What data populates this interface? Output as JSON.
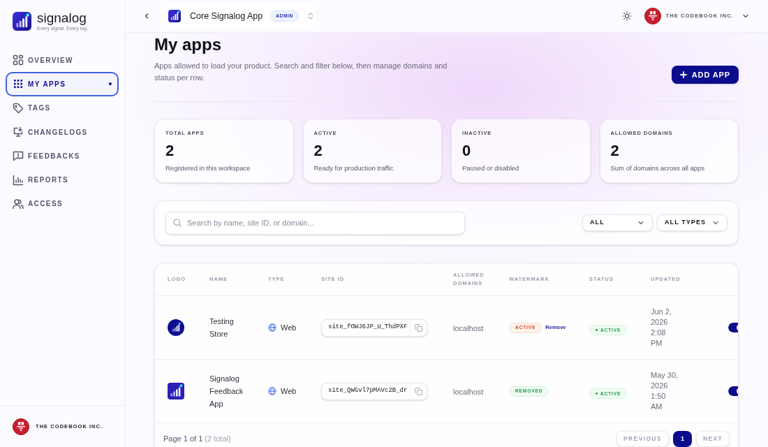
{
  "sidebar": {
    "brand": {
      "name": "signalog",
      "tagline": "Every signal. Every log."
    },
    "items": [
      {
        "label": "OVERVIEW",
        "selected": false
      },
      {
        "label": "MY APPS",
        "selected": true
      },
      {
        "label": "TAGS",
        "selected": false
      },
      {
        "label": "CHANGELOGS",
        "selected": false
      },
      {
        "label": "FEEDBACKS",
        "selected": false
      },
      {
        "label": "REPORTS",
        "selected": false
      },
      {
        "label": "ACCESS",
        "selected": false
      }
    ],
    "org": {
      "name": "THE CODEBOOK INC."
    }
  },
  "topbar": {
    "app": {
      "name": "Core Signalog App",
      "badge": "ADMIN"
    },
    "org": {
      "name": "THE CODEBOOK INC."
    }
  },
  "header": {
    "title": "My apps",
    "description": "Apps allowed to load your product. Search and filter below, then manage domains and status per row.",
    "action": "ADD APP"
  },
  "stats": [
    {
      "label": "TOTAL APPS",
      "value": "2",
      "note": "Registered in this workspace"
    },
    {
      "label": "ACTIVE",
      "value": "2",
      "note": "Ready for production traffic"
    },
    {
      "label": "INACTIVE",
      "value": "0",
      "note": "Paused or disabled"
    },
    {
      "label": "ALLOWED DOMAINS",
      "value": "2",
      "note": "Sum of domains across all apps"
    }
  ],
  "filters": {
    "search": {
      "placeholder": "Search by name, site ID, or domain..."
    },
    "selects": [
      {
        "value": "ALL"
      },
      {
        "value": "ALL TYPES"
      }
    ]
  },
  "table": {
    "columns": [
      "LOGO",
      "NAME",
      "TYPE",
      "SITE ID",
      "ALLOWED DOMAINS",
      "WATERMARK",
      "STATUS",
      "UPDATED"
    ],
    "rows": [
      {
        "logo": {
          "kind": "circle"
        },
        "name": "Testing Store",
        "type": "Web",
        "site_id": "site_fOWJ6JP_U_ThdPXF",
        "domains": "localhost",
        "watermark": {
          "kind": "active",
          "label": "ACTIVE",
          "action": "Remove"
        },
        "status": {
          "kind": "active",
          "label": "ACTIVE"
        },
        "updated": "Jun 2, 2026 2:08 PM",
        "on": true
      },
      {
        "logo": {
          "kind": "square"
        },
        "name": "Signalog Feedback App",
        "type": "Web",
        "site_id": "site_QWGvl7pMAVc2B_dr",
        "domains": "localhost",
        "watermark": {
          "kind": "removed",
          "label": "REMOVED"
        },
        "status": {
          "kind": "active",
          "label": "ACTIVE"
        },
        "updated": "May 30, 2026 1:50 AM",
        "on": true
      }
    ]
  },
  "pagination": {
    "summary": "Page 1 of 1",
    "total": "(2 total)",
    "previous": {
      "label": "PREVIOUS",
      "disabled": true
    },
    "pages": [
      {
        "label": "1",
        "selected": true
      }
    ],
    "next": {
      "label": "NEXT",
      "disabled": true
    }
  }
}
